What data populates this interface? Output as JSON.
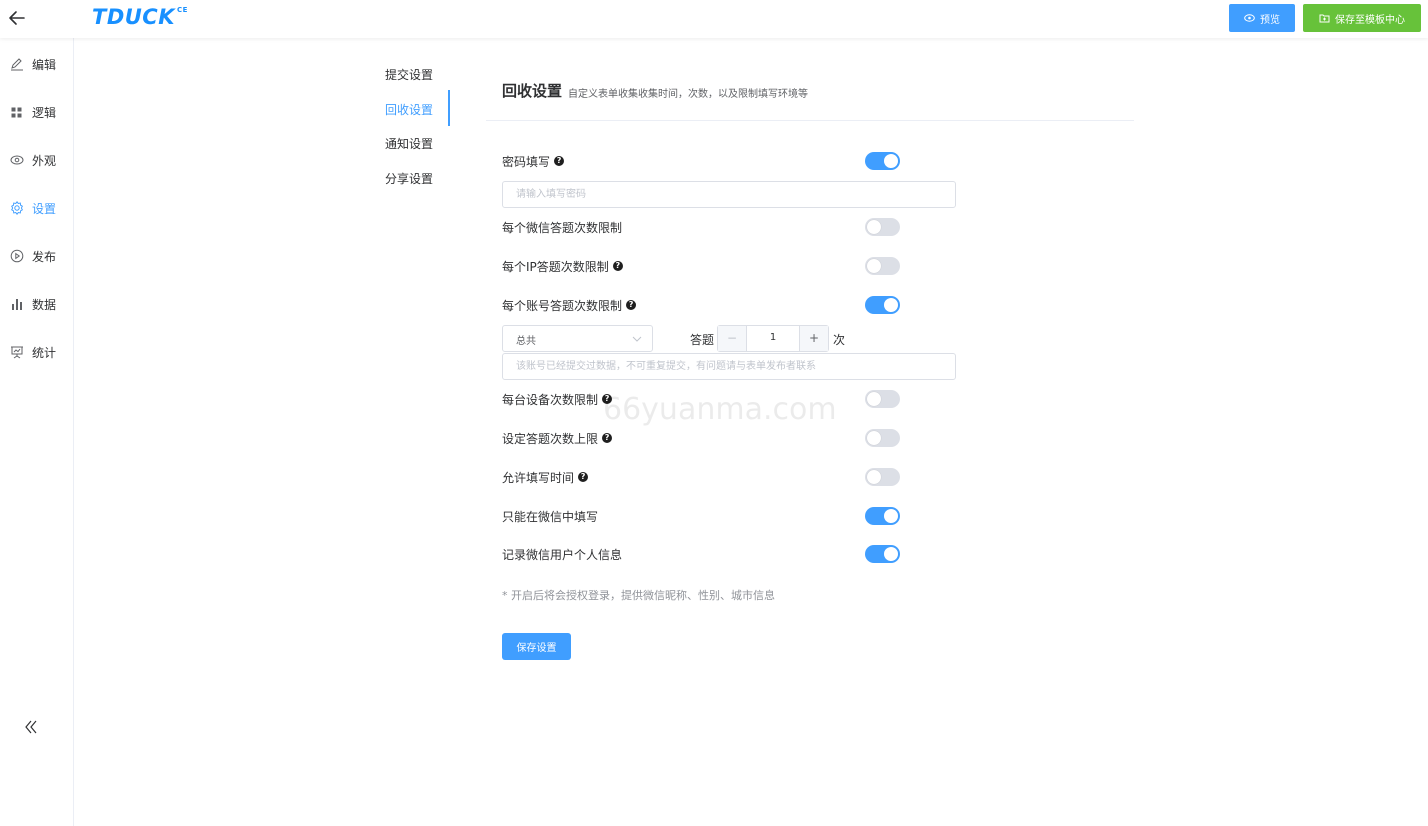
{
  "colors": {
    "primary": "#409eff",
    "success": "#67c23a",
    "switch_off": "#dcdfe6",
    "logo": "#1890ff"
  },
  "header": {
    "logo": "TDUCK",
    "logo_sup": "CE",
    "preview_label": "预览",
    "template_label": "保存至模板中心"
  },
  "sidebar": {
    "items": [
      {
        "label": "编辑",
        "icon": "pencil-icon",
        "active": false
      },
      {
        "label": "逻辑",
        "icon": "grid-icon",
        "active": false
      },
      {
        "label": "外观",
        "icon": "eye-icon",
        "active": false
      },
      {
        "label": "设置",
        "icon": "gear-icon",
        "active": true
      },
      {
        "label": "发布",
        "icon": "play-circle-icon",
        "active": false
      },
      {
        "label": "数据",
        "icon": "bar-chart-icon",
        "active": false
      },
      {
        "label": "统计",
        "icon": "presentation-chart-icon",
        "active": false
      }
    ],
    "collapse_icon": "double-chevron-left-icon"
  },
  "submenu": {
    "items": [
      {
        "label": "提交设置",
        "active": false
      },
      {
        "label": "回收设置",
        "active": true
      },
      {
        "label": "通知设置",
        "active": false
      },
      {
        "label": "分享设置",
        "active": false
      }
    ]
  },
  "section": {
    "title": "回收设置",
    "desc": "自定义表单收集收集时间，次数，以及限制填写环境等"
  },
  "settings": {
    "password": {
      "label": "密码填写",
      "on": true,
      "placeholder": "请输入填写密码"
    },
    "wechat_limit": {
      "label": "每个微信答题次数限制",
      "on": false
    },
    "ip_limit": {
      "label": "每个IP答题次数限制",
      "on": false
    },
    "account_limit": {
      "label": "每个账号答题次数限制",
      "on": true,
      "period": "总共",
      "count_label": "答题",
      "count": "1",
      "unit": "次",
      "placeholder": "该账号已经提交过数据，不可重复提交，有问题请与表单发布者联系"
    },
    "device_limit": {
      "label": "每台设备次数限制",
      "on": false
    },
    "max_limit": {
      "label": "设定答题次数上限",
      "on": false
    },
    "time_limit": {
      "label": "允许填写时间",
      "on": false
    },
    "wechat_only": {
      "label": "只能在微信中填写",
      "on": true
    },
    "wechat_userinfo": {
      "label": "记录微信用户个人信息",
      "on": true
    }
  },
  "note": "* 开启后将会授权登录，提供微信昵称、性别、城市信息",
  "save_label": "保存设置",
  "watermark": "66yuanma.com"
}
